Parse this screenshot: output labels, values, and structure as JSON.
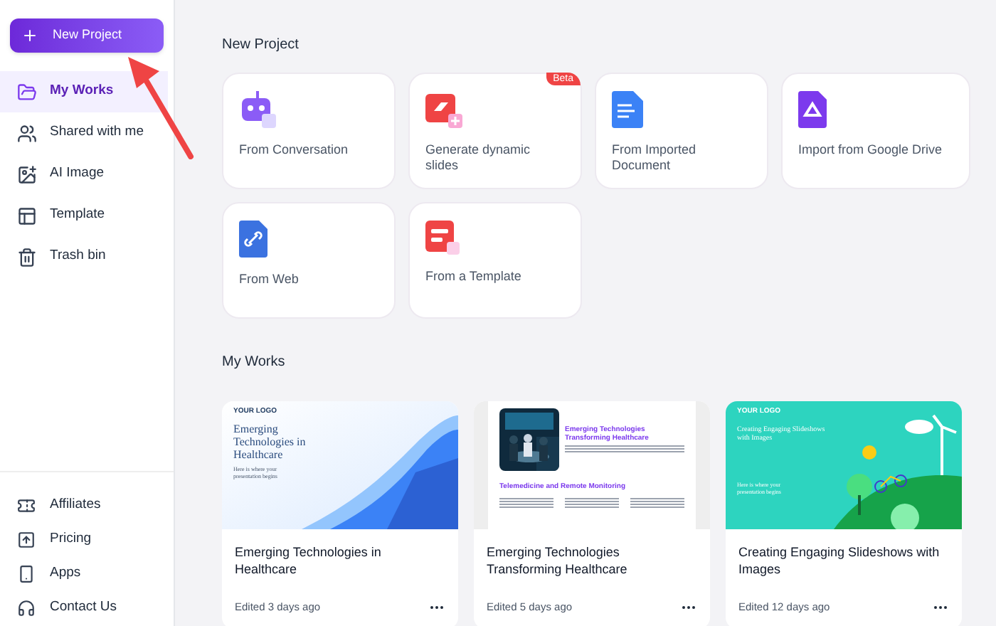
{
  "new_project_button": {
    "label": "New Project"
  },
  "sidebar": {
    "items": [
      {
        "label": "My Works",
        "selected": true
      },
      {
        "label": "Shared with me",
        "selected": false
      },
      {
        "label": "AI Image",
        "selected": false
      },
      {
        "label": "Template",
        "selected": false
      },
      {
        "label": "Trash bin",
        "selected": false
      }
    ],
    "bottom_items": [
      {
        "label": "Affiliates"
      },
      {
        "label": "Pricing"
      },
      {
        "label": "Apps"
      },
      {
        "label": "Contact Us"
      }
    ]
  },
  "new_project": {
    "heading": "New Project",
    "options": [
      {
        "label": "From Conversation"
      },
      {
        "label": "Generate dynamic slides",
        "badge": "Beta"
      },
      {
        "label": "From Imported Document"
      },
      {
        "label": "Import from Google Drive"
      },
      {
        "label": "From Web"
      },
      {
        "label": "From a Template"
      }
    ]
  },
  "my_works": {
    "heading": "My Works",
    "projects": [
      {
        "title": "Emerging Technologies in Healthcare",
        "edited": "Edited 3 days ago",
        "thumbnail": {
          "kind": "wave",
          "logo": "YOUR LOGO",
          "title": "Emerging Technologies in Healthcare",
          "subtitle": "Here is where your presentation begins"
        }
      },
      {
        "title": "Emerging Technologies Transforming Healthcare",
        "edited": "Edited 5 days ago",
        "thumbnail": {
          "kind": "document",
          "title": "Emerging Technologies Transforming Healthcare",
          "section": "Telemedicine and Remote Monitoring"
        }
      },
      {
        "title": "Creating Engaging Slideshows with Images",
        "edited": "Edited 12 days ago",
        "thumbnail": {
          "kind": "illustration",
          "logo": "YOUR LOGO",
          "title": "Creating Engaging Slideshows with Images",
          "subtitle": "Here is where your presentation begins"
        }
      }
    ]
  }
}
